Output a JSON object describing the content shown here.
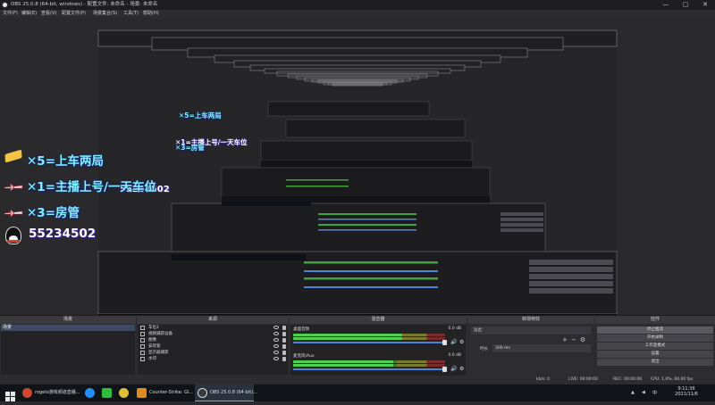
{
  "window": {
    "title": "OBS 25.0.8 (64-bit, windows) - 配置文件: 未命名 - 场景: 未命名",
    "minimize": "—",
    "maximize": "▢",
    "close": "✕"
  },
  "menu": [
    "文件(F)",
    "编辑(E)",
    "查看(V)",
    "配置文件(P)",
    "场景集合(S)",
    "工具(T)",
    "帮助(H)"
  ],
  "overlay": {
    "line1": "✕5=上车两局",
    "line2": "✕1=主播上号/一天车位",
    "line3": "✕3=房管",
    "qq": "55234502",
    "small_line1": "✕5=上车两局",
    "small_line2": "✕1=主播上号/一天车位",
    "small_line3": "✕3=房管",
    "small_qq": "55234502"
  },
  "docks": {
    "scenes": {
      "title": "场景",
      "items": [
        "场景"
      ]
    },
    "sources": {
      "title": "来源",
      "items": [
        "车位2",
        "视频捕获设备",
        "图像",
        "安装管",
        "显示器捕获",
        "水印"
      ]
    },
    "mixer": {
      "title": "混音器",
      "channels": [
        {
          "name": "桌面音频",
          "db": "0.0 dB",
          "level": 0.72
        },
        {
          "name": "麦克风/Aux",
          "db": "0.0 dB",
          "level": 0.66
        }
      ]
    },
    "transitions": {
      "title": "转场特效",
      "select": "淡出",
      "duration_label": "时长",
      "duration": "300 ms"
    },
    "controls": {
      "title": "控件",
      "buttons": [
        "停止推流",
        "开始录制",
        "工作室模式",
        "设置",
        "退出"
      ]
    }
  },
  "dock_footer": {
    "add": "+",
    "remove": "−",
    "up": "⋀",
    "down": "⋁",
    "gear": "⚙"
  },
  "status": {
    "live": "LIVE: 00:00:00",
    "rec": "REC: 00:00:00",
    "cpu": "CPU: 1.0%, 60.00 fps",
    "kbps": "kb/s: 0"
  },
  "taskbar": {
    "apps": [
      {
        "label": "rogelo游戏频道直播...",
        "color": "#d2452f"
      },
      {
        "label": "",
        "color": "#1e90ff"
      },
      {
        "label": "",
        "color": "#2dbd3a"
      },
      {
        "label": "",
        "color": "#e0c030"
      },
      {
        "label": "Counter-Strike: Gl...",
        "color": "#e08a1e"
      },
      {
        "label": "OBS 25.0.8 (64-bit)...",
        "color": "#3a3a3a"
      }
    ],
    "time": "9:11:36",
    "date": "2021/11/6",
    "lang": "中"
  },
  "colors": {
    "accent": "#4a86d8",
    "meter_green": "#4cd14c",
    "overlay_cyan": "#7ef2ff"
  }
}
